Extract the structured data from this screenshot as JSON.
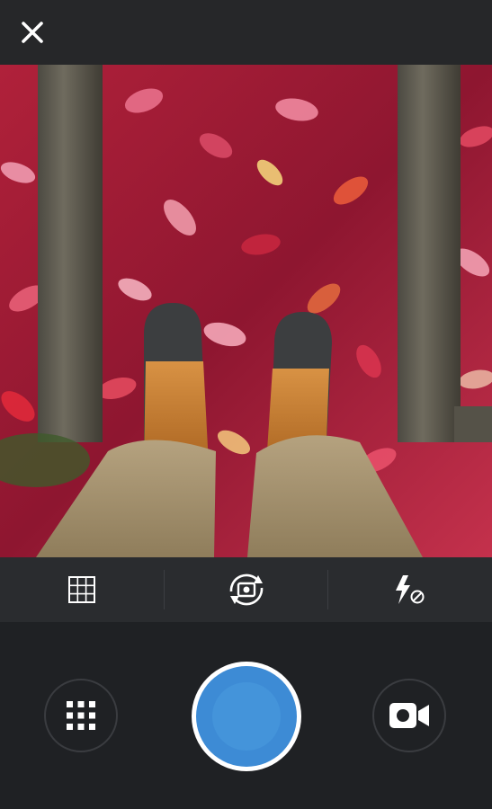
{
  "top_bar": {
    "close_icon": "close-icon"
  },
  "viewfinder": {
    "scene": "camera-preview-photo"
  },
  "toolbar": {
    "grid_icon": "grid-icon",
    "switch_camera_icon": "switch-camera-icon",
    "flash_icon": "flash-off-icon"
  },
  "controls": {
    "gallery_icon": "gallery-grid-icon",
    "shutter_icon": "shutter-button",
    "video_icon": "video-camera-icon"
  },
  "colors": {
    "background": "#1f2124",
    "top_bar": "#262729",
    "toolbar": "#2a2c2f",
    "shutter_blue": "#3d8bd5",
    "shutter_ring": "#ffffff",
    "icon": "#ffffff"
  }
}
